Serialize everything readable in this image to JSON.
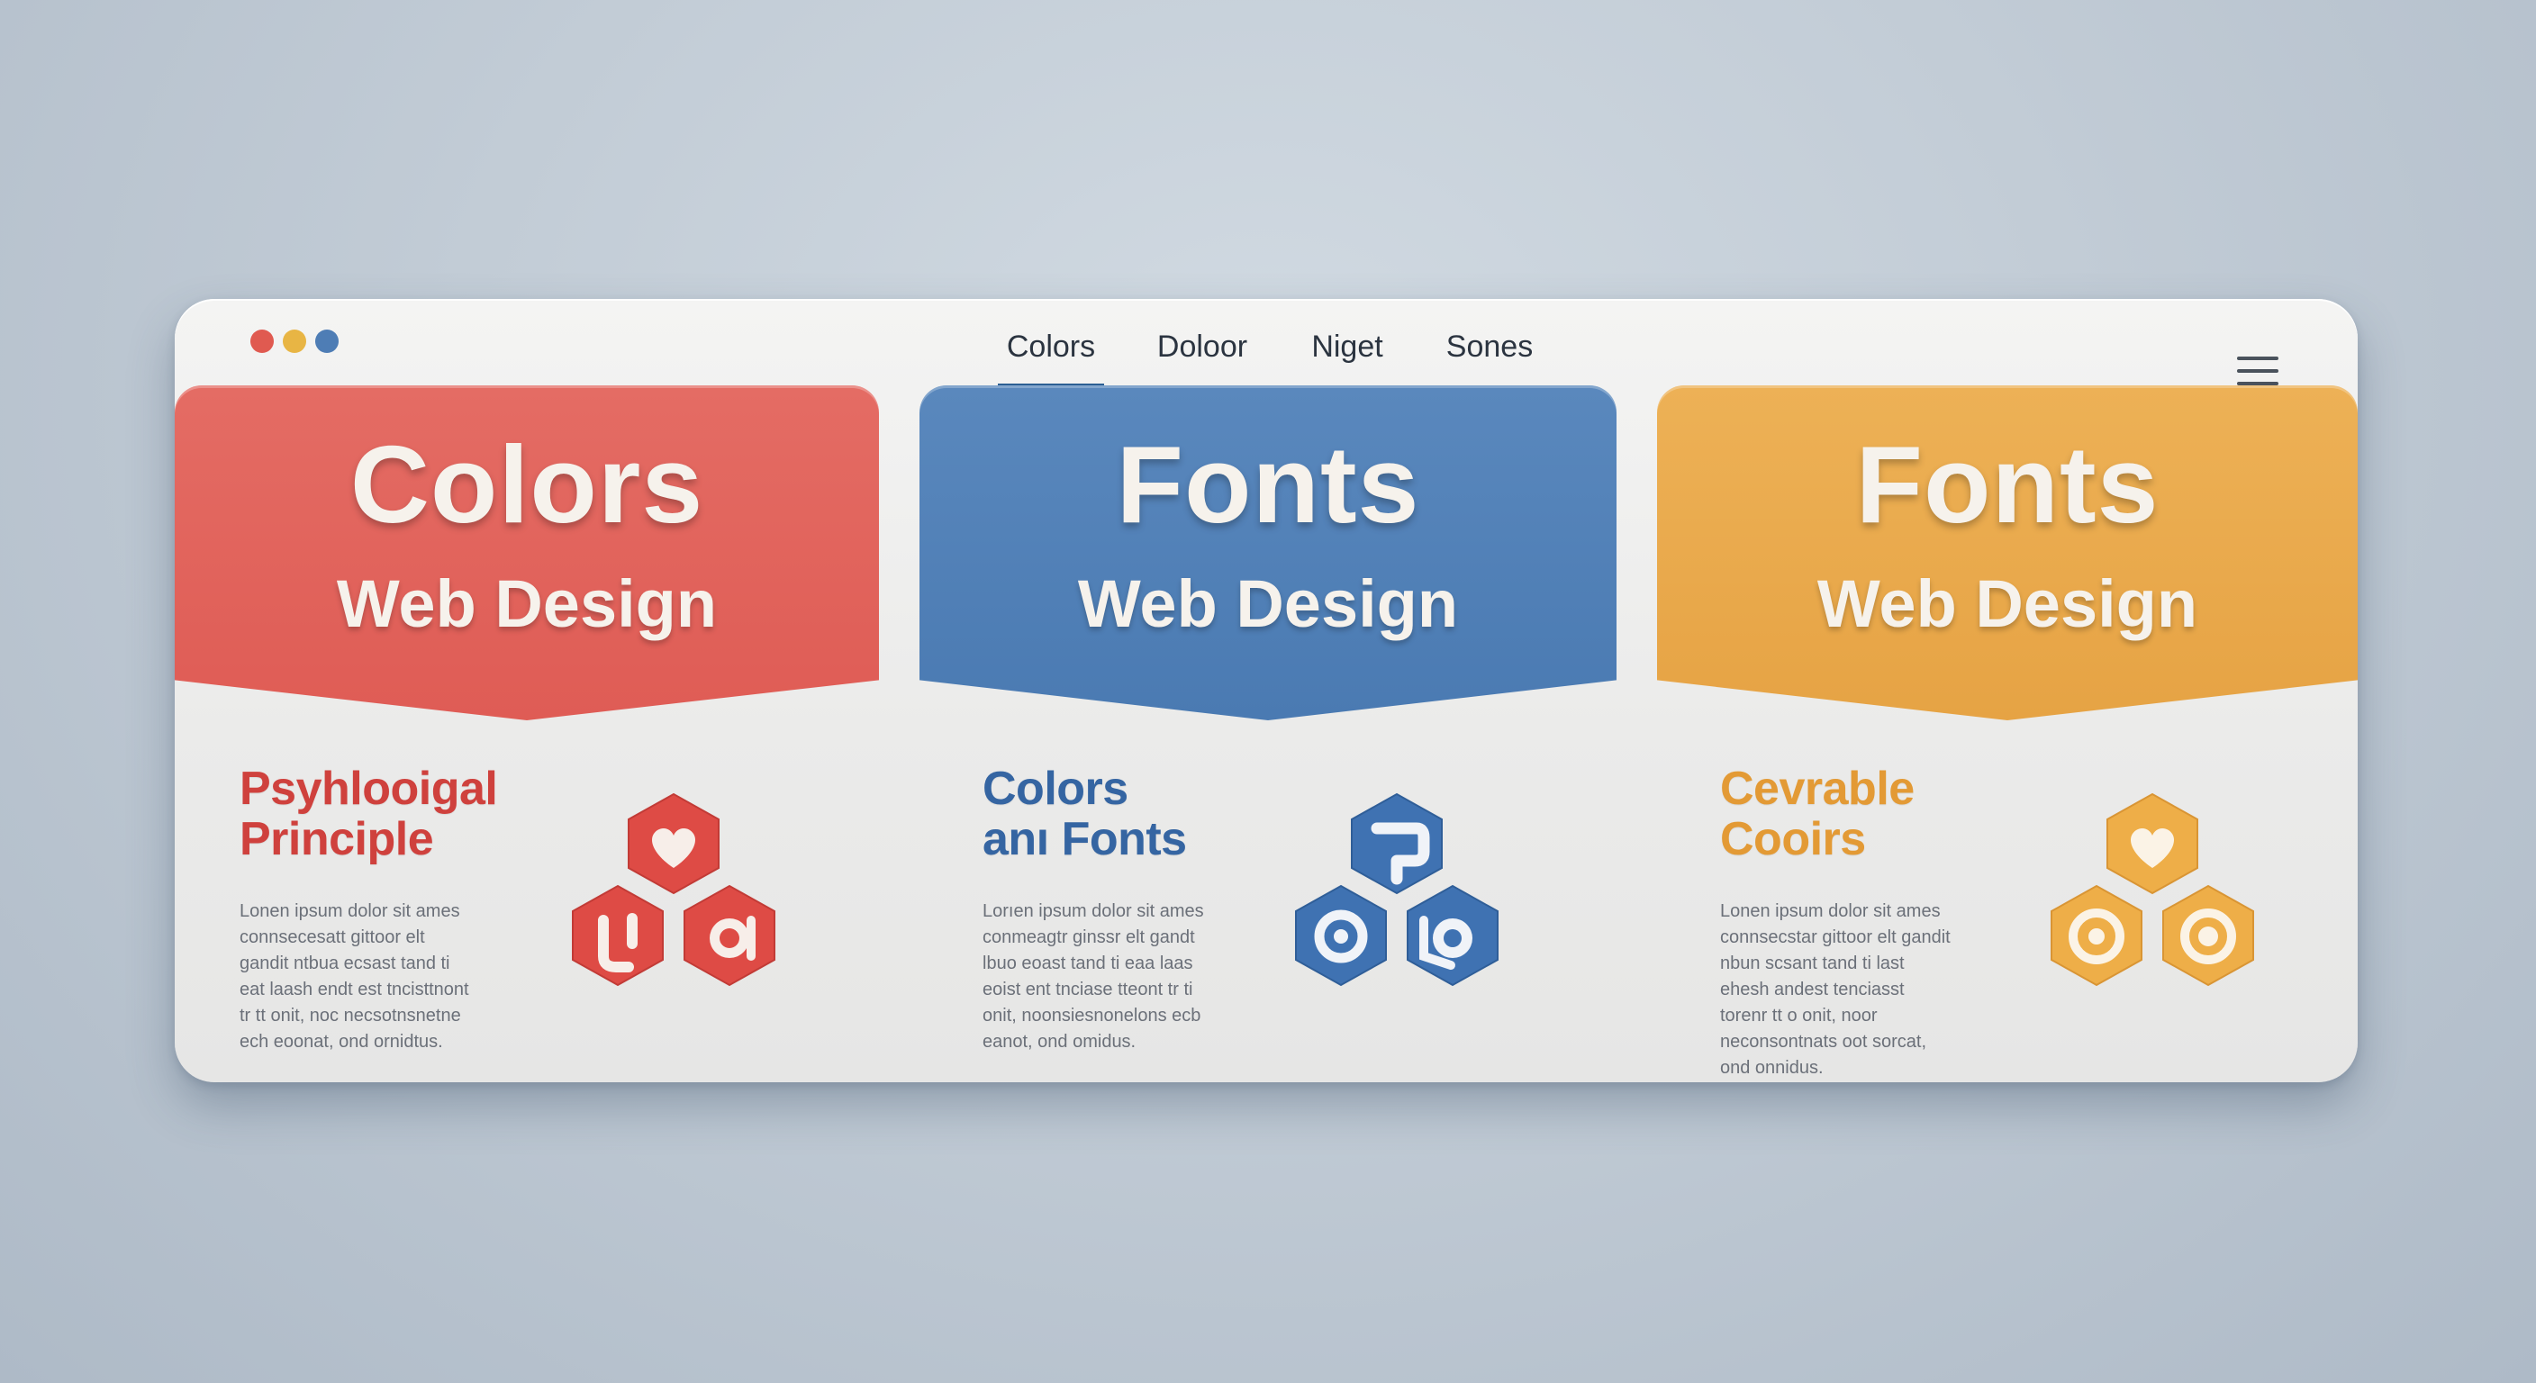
{
  "window": {
    "traffic_lights": [
      "#e05a50",
      "#e8b544",
      "#4e7db5"
    ]
  },
  "nav": {
    "tabs": [
      {
        "label": "Colors",
        "active": true
      },
      {
        "label": "Doloor",
        "active": false
      },
      {
        "label": "Niget",
        "active": false
      },
      {
        "label": "Sones",
        "active": false
      }
    ],
    "menu_icon": "hamburger-menu-icon"
  },
  "cards": [
    {
      "title": "Colors",
      "subtitle": "Web Design",
      "color": "#e0625b",
      "heading_lines": [
        "Psyhlooigal",
        "Principle"
      ],
      "heading_color": "#cf413d",
      "body": "Lonen ipsum dolor sit ames connsecesatt gittoor elt gandit ntbua ecsast tand ti eat laash endt est tncisttnont tr tt onit, noc necsotnsnetne ech eoonat, ond ornidtus.",
      "icon": "hexagon-hearts-icon",
      "icon_color": "#de4b45"
    },
    {
      "title": "Fonts",
      "subtitle": "Web Design",
      "color": "#4f7fb6",
      "heading_lines": [
        "Colors",
        "anı Fonts"
      ],
      "heading_color": "#3565a2",
      "body": "Lorıen ipsum dolor sit ames conmeagtr ginssr elt gandt lbuo eoast tand ti eaa laas eoist ent tnciase tteont tr ti onit, noonsiesnonelons ecb eanot, ond omidus.",
      "icon": "hexagon-links-icon",
      "icon_color": "#3f72b2"
    },
    {
      "title": "Fonts",
      "subtitle": "Web Design",
      "color": "#e9a94a",
      "heading_lines": [
        "Cevrable",
        "Cooirs"
      ],
      "heading_color": "#e39a35",
      "body": "Lonen ipsum dolor sit ames connsecstar gittoor elt gandit nbun scsant tand ti last ehesh andest tenciasst torenr tt o onit, noor neconsontnats oot sorcat, ond onnidus.",
      "icon": "hexagon-hearts-icon",
      "icon_color": "#eeae48"
    }
  ]
}
